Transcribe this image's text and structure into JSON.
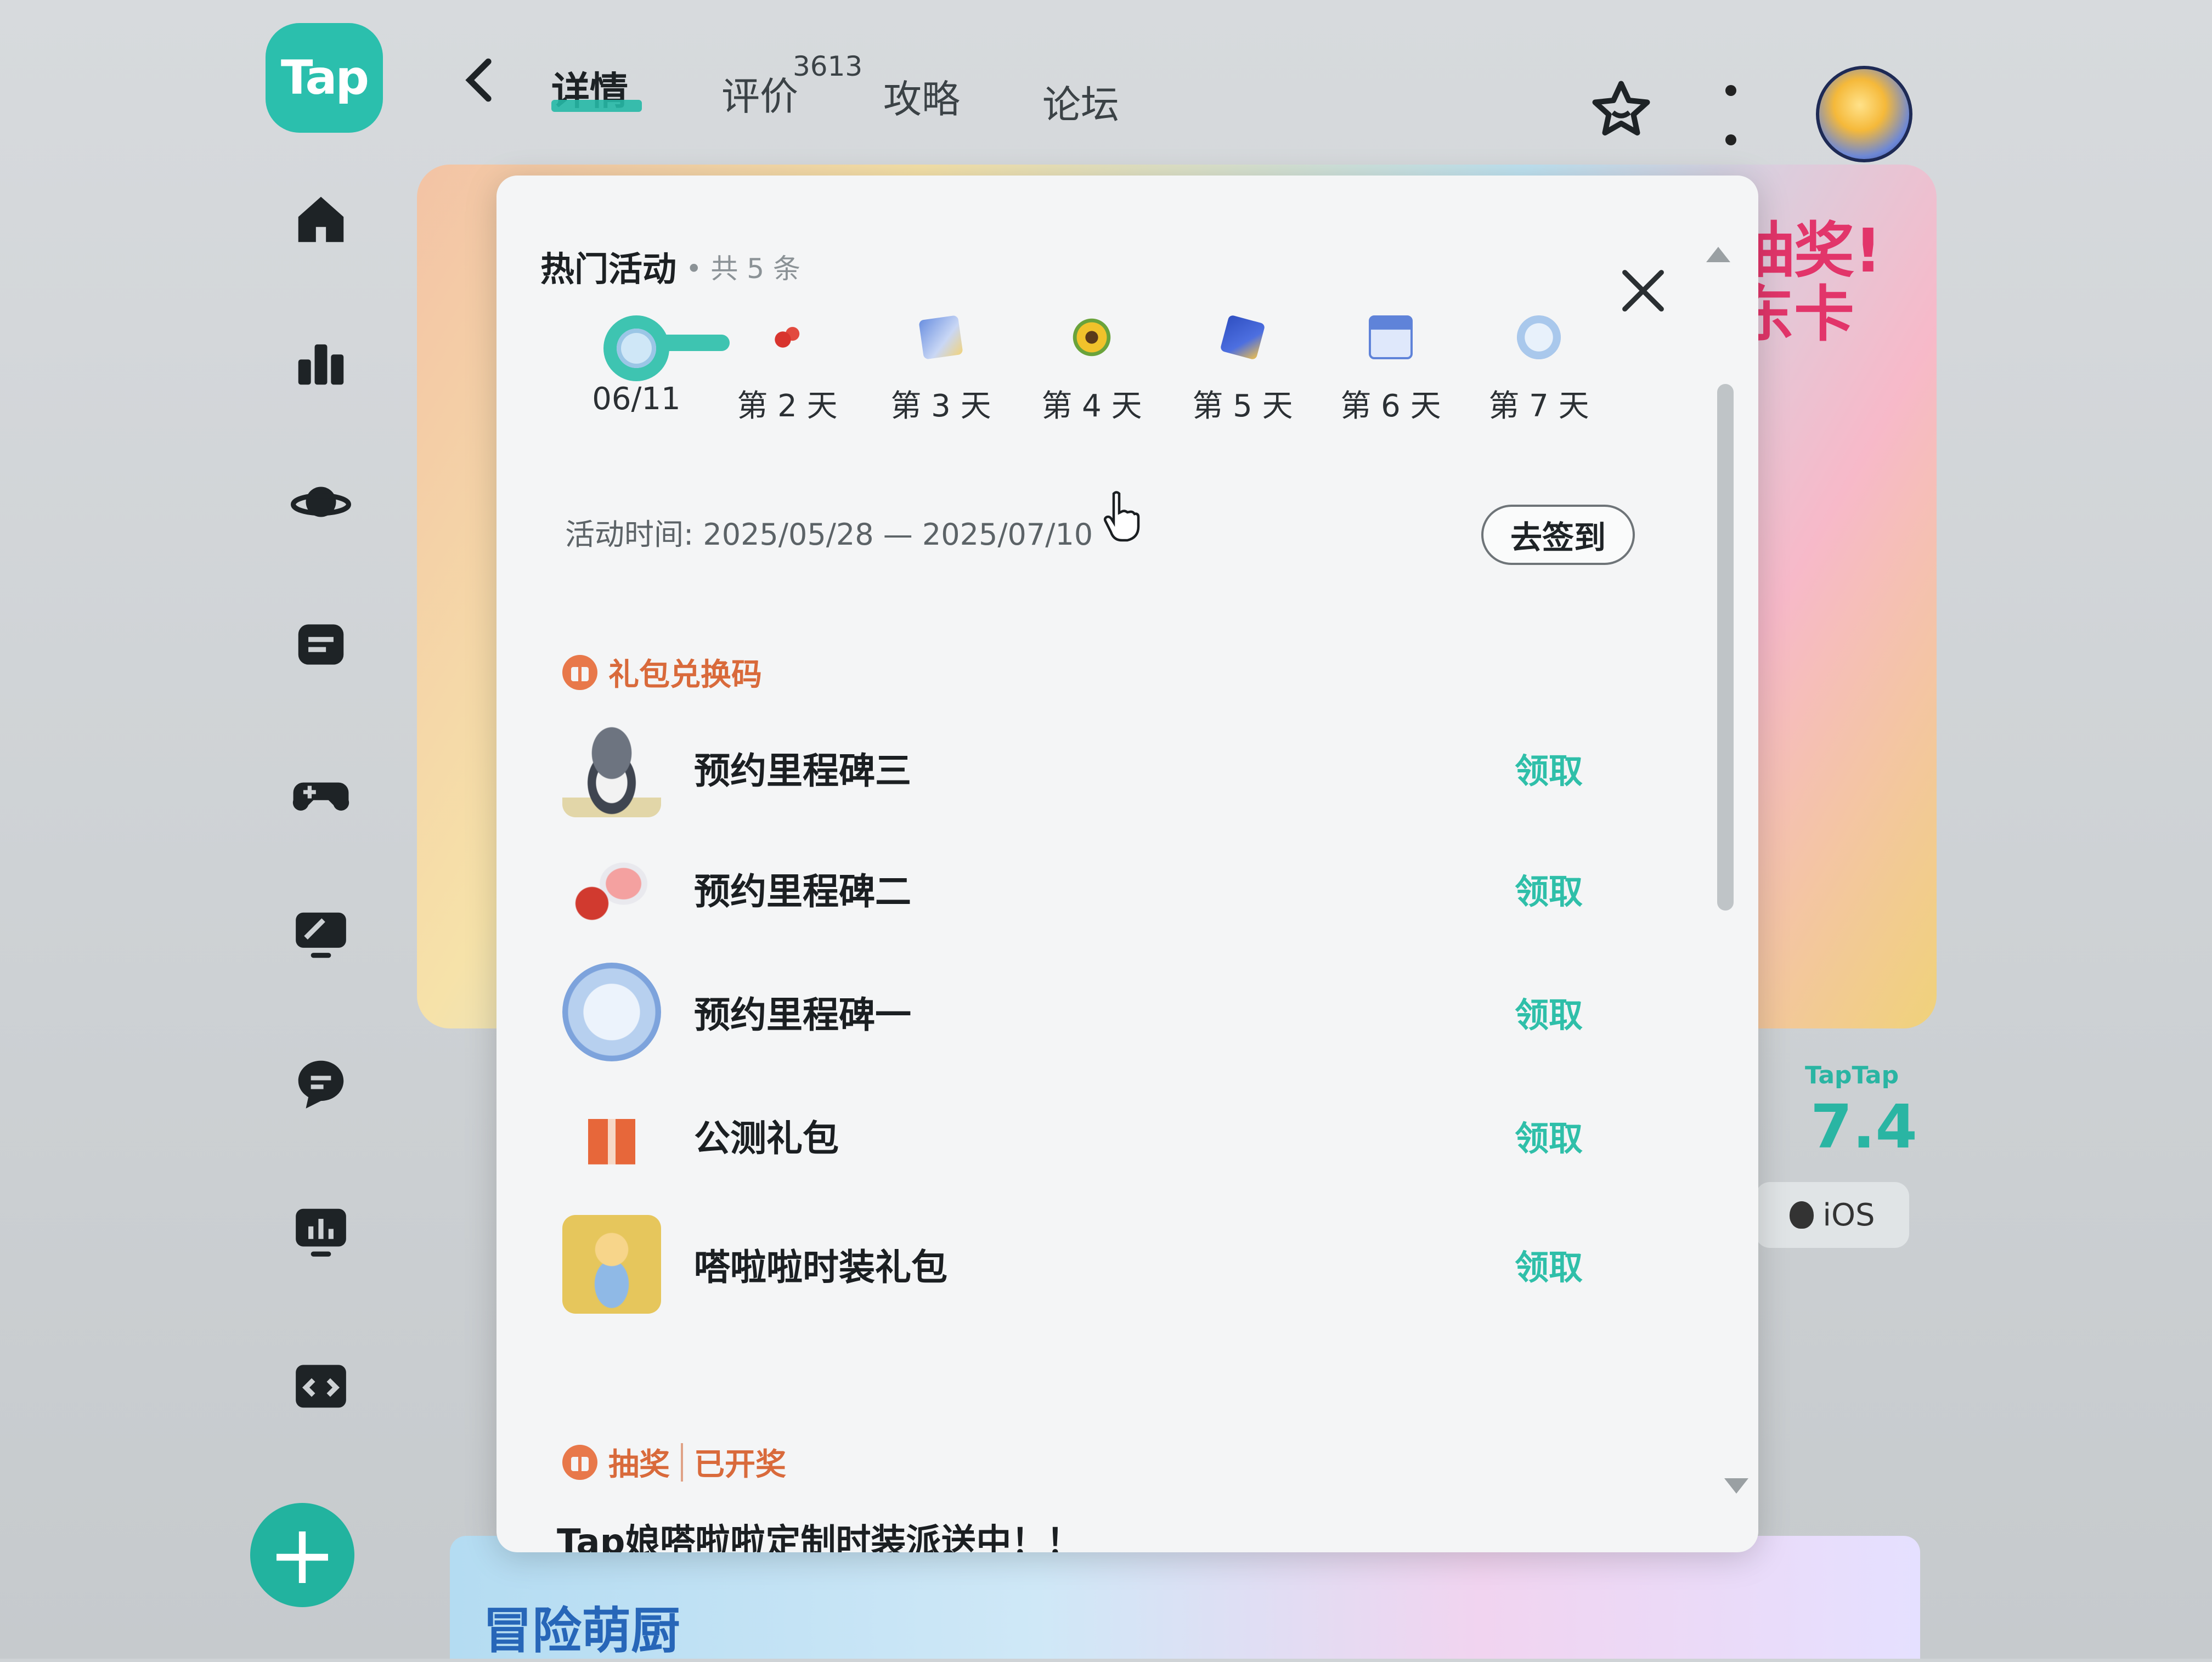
{
  "app": {
    "logo_text": "Tap"
  },
  "header": {
    "tabs": [
      {
        "label": "详情",
        "active": true
      },
      {
        "label": "评价",
        "count": "3613",
        "active": false
      },
      {
        "label": "攻略",
        "active": false
      },
      {
        "label": "论坛",
        "active": false
      }
    ]
  },
  "sidebar": {
    "items": [
      {
        "icon": "home-icon"
      },
      {
        "icon": "ranking-icon"
      },
      {
        "icon": "planet-icon"
      },
      {
        "icon": "message-icon"
      },
      {
        "icon": "gamepad-icon"
      },
      {
        "icon": "cloud-play-icon"
      },
      {
        "icon": "chat-bubble-icon"
      },
      {
        "icon": "stats-icon"
      },
      {
        "icon": "code-icon"
      }
    ],
    "add_label": "+"
  },
  "background": {
    "banner_text_line1": "抽奖!",
    "banner_text_line2": "东卡",
    "rating_brand": "TapTap",
    "rating_value": "7.4",
    "platform_label": "iOS",
    "bottom_banner_title": "冒险萌厨",
    "left_peek_char": "# "
  },
  "modal": {
    "title": "热门活动",
    "count_text": "• 共 5 条",
    "days": [
      {
        "label": "06/11",
        "current": true
      },
      {
        "label": "第 2 天"
      },
      {
        "label": "第 3 天"
      },
      {
        "label": "第 4 天"
      },
      {
        "label": "第 5 天"
      },
      {
        "label": "第 6 天"
      },
      {
        "label": "第 7 天"
      }
    ],
    "activity_time": "活动时间: 2025/05/28 — 2025/07/10",
    "signin_button": "去签到",
    "gift_section": {
      "title": "礼包兑换码",
      "items": [
        {
          "name": "预约里程碑三",
          "action": "领取"
        },
        {
          "name": "预约里程碑二",
          "action": "领取"
        },
        {
          "name": "预约里程碑一",
          "action": "领取"
        },
        {
          "name": "公测礼包",
          "action": "领取"
        },
        {
          "name": "嗒啦啦时装礼包",
          "action": "领取"
        }
      ]
    },
    "lottery_section": {
      "title": "抽奖",
      "status": "已开奖",
      "text": "Tap娘嗒啦啦定制时装派送中！！"
    }
  },
  "colors": {
    "accent": "#2fbfa9",
    "section_orange": "#d96a3b"
  }
}
